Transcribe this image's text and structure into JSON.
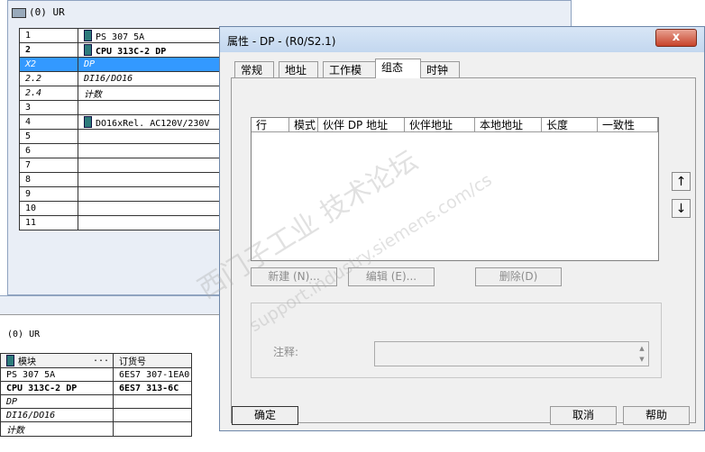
{
  "rack": {
    "title": "(0) UR",
    "rows": [
      {
        "slot": "1",
        "module": "PS 307 5A",
        "style": "",
        "icon": true
      },
      {
        "slot": "2",
        "module": "CPU 313C-2 DP",
        "style": "b",
        "icon": true
      },
      {
        "slot": "X2",
        "module": "DP",
        "style": "it",
        "icon": false,
        "selected": true
      },
      {
        "slot": "2.2",
        "module": "DI16/DO16",
        "style": "it",
        "icon": false
      },
      {
        "slot": "2.4",
        "module": "计数",
        "style": "it",
        "icon": false
      },
      {
        "slot": "3",
        "module": "",
        "style": "",
        "icon": false
      },
      {
        "slot": "4",
        "module": "DO16xRel. AC120V/230V",
        "style": "",
        "icon": true
      },
      {
        "slot": "5",
        "module": "",
        "style": "",
        "icon": false
      },
      {
        "slot": "6",
        "module": "",
        "style": "",
        "icon": false
      },
      {
        "slot": "7",
        "module": "",
        "style": "",
        "icon": false
      },
      {
        "slot": "8",
        "module": "",
        "style": "",
        "icon": false
      },
      {
        "slot": "9",
        "module": "",
        "style": "",
        "icon": false
      },
      {
        "slot": "10",
        "module": "",
        "style": "",
        "icon": false
      },
      {
        "slot": "11",
        "module": "",
        "style": "",
        "icon": false
      }
    ]
  },
  "detail": {
    "title": "(0)    UR",
    "headers": [
      "模块",
      "...",
      "订货号"
    ],
    "rows": [
      {
        "module": "PS 307 5A",
        "order": "6ES7 307-1EA0"
      },
      {
        "module": "CPU 313C-2 DP",
        "order": "6ES7 313-6C"
      },
      {
        "module": "DP",
        "order": ""
      },
      {
        "module": "DI16/DO16",
        "order": ""
      },
      {
        "module": "计数",
        "order": ""
      }
    ]
  },
  "dialog": {
    "title": "属性 - DP - (R0/S2.1)",
    "close_symbol": "x",
    "tabs": [
      "常规",
      "地址",
      "工作模式",
      "组态",
      "时钟"
    ],
    "active_tab": "组态",
    "columns": [
      "行",
      "模式",
      "伙伴 DP 地址",
      "伙伴地址",
      "本地地址",
      "长度",
      "一致性"
    ],
    "buttons": {
      "new": "新建 (N)...",
      "edit": "编辑 (E)...",
      "delete": "删除(D)"
    },
    "comment_label": "注释:",
    "ok": "确定",
    "cancel": "取消",
    "help": "帮助",
    "up_symbol": "↑",
    "down_symbol": "↓"
  },
  "watermark": {
    "line1": "西门子工业  技术论坛",
    "line2": "support.industry.siemens.com/cs"
  },
  "colors": {
    "selection": "#3399ff",
    "close_button": "#c7432a"
  }
}
